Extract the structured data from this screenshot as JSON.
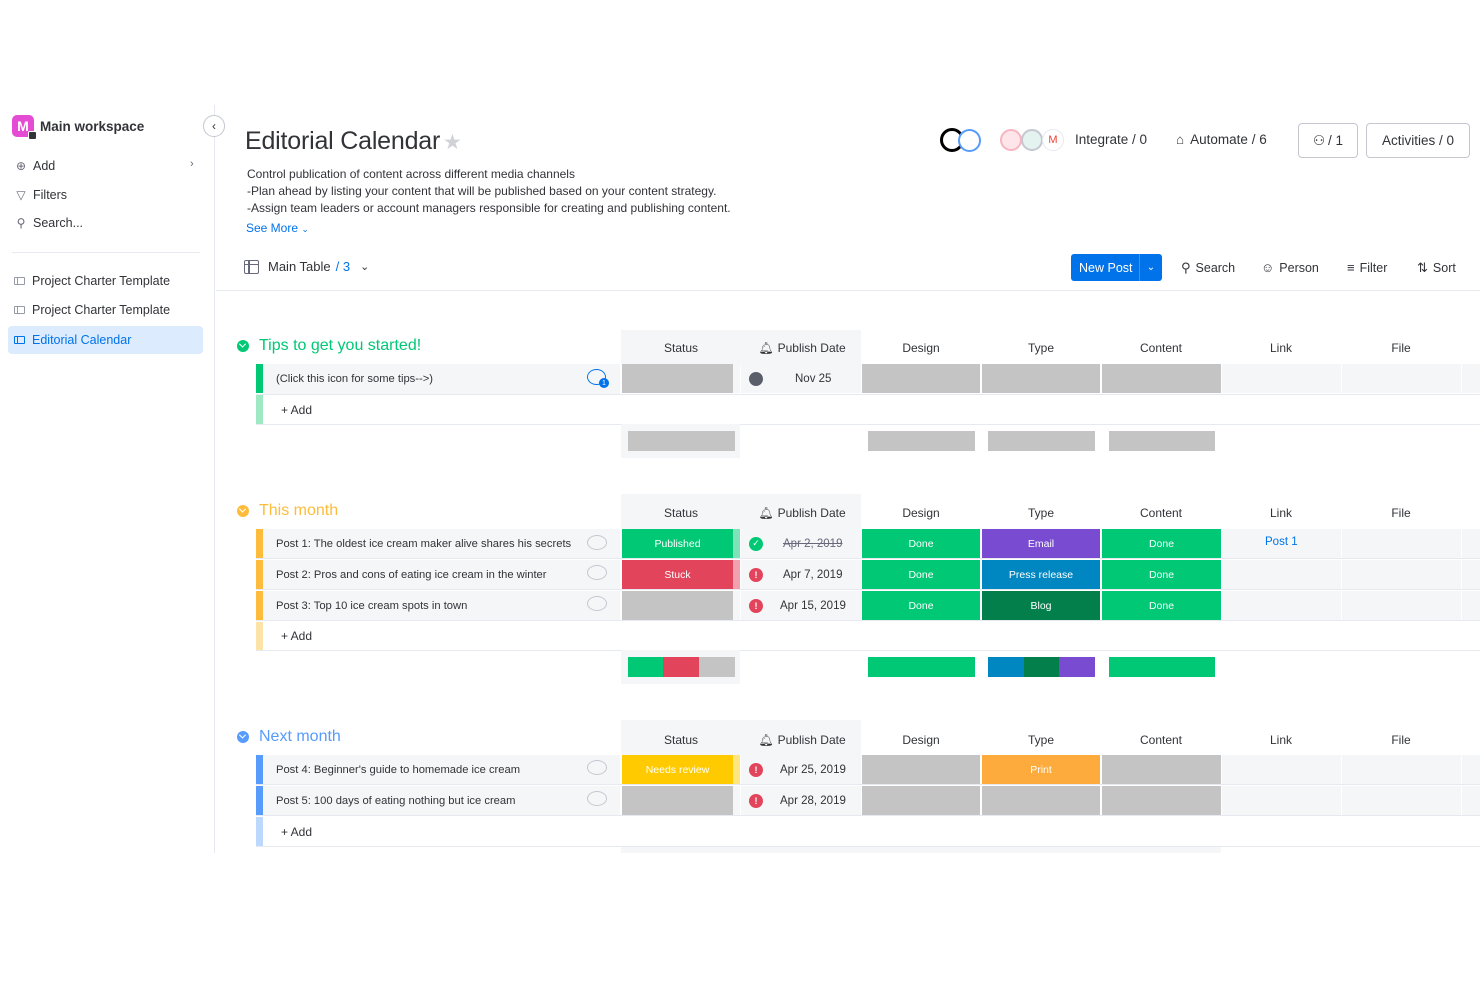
{
  "workspace": {
    "logo_letter": "M",
    "name": "Main workspace"
  },
  "sidebar": {
    "actions": [
      {
        "icon": "plus-circle-icon",
        "label": "Add"
      },
      {
        "icon": "filter-icon",
        "label": "Filters"
      },
      {
        "icon": "search-icon",
        "label": "Search..."
      }
    ],
    "boards": [
      {
        "label": "Project Charter Template",
        "active": false
      },
      {
        "label": "Project Charter Template",
        "active": false
      },
      {
        "label": "Editorial Calendar",
        "active": true
      }
    ]
  },
  "board": {
    "title": "Editorial Calendar",
    "description": [
      "Control publication of content across different media channels",
      "-Plan ahead by listing your content that will be published based on your content strategy.",
      "-Assign team leaders or account managers responsible for creating and publishing content."
    ],
    "see_more": "See More"
  },
  "header_actions": {
    "integrate": "Integrate / 0",
    "automate": "Automate / 6",
    "members": "/ 1",
    "activities": "Activities / 0"
  },
  "toolbar": {
    "view_name": "Main Table",
    "view_count": "/ 3",
    "new_item": "New Post",
    "search": "Search",
    "person": "Person",
    "filter": "Filter",
    "sort": "Sort"
  },
  "columns": [
    "Status",
    "Publish Date",
    "Design",
    "Type",
    "Content",
    "Link",
    "File"
  ],
  "colors": {
    "green": "#00c875",
    "red": "#e2445c",
    "purple": "#784bd1",
    "blue": "#0086c0",
    "dark_green": "#037f4c",
    "yellow": "#fdbc3c",
    "orange": "#fdab3d",
    "grey": "#c4c4c4",
    "accent": "#0073ea"
  },
  "groups": [
    {
      "title": "Tips to get you started!",
      "color": "#00c875",
      "add_label": "+ Add",
      "rows": [
        {
          "name": "(Click this icon for some tips-->)",
          "status": "",
          "date": "Nov 25",
          "date_state": "clock"
        }
      ]
    },
    {
      "title": "This month",
      "color": "#fdbc3c",
      "add_label": "+ Add",
      "rows": [
        {
          "name": "Post 1: The oldest ice cream maker alive shares his secrets",
          "status": "Published",
          "date": "Apr 2, 2019",
          "date_state": "done",
          "design": "Done",
          "type": "Email",
          "content": "Done",
          "link": "Post 1"
        },
        {
          "name": "Post 2: Pros and cons of eating ice cream in the winter",
          "status": "Stuck",
          "date": "Apr 7, 2019",
          "date_state": "overdue",
          "design": "Done",
          "type": "Press release",
          "content": "Done"
        },
        {
          "name": "Post 3: Top 10 ice cream spots in town",
          "status": "",
          "date": "Apr 15, 2019",
          "date_state": "overdue",
          "design": "Done",
          "type": "Blog",
          "content": "Done"
        }
      ]
    },
    {
      "title": "Next month",
      "color": "#579bfc",
      "add_label": "+ Add",
      "rows": [
        {
          "name": "Post 4: Beginner's guide to homemade ice cream",
          "status": "Needs review",
          "date": "Apr 25, 2019",
          "date_state": "overdue",
          "type": "Print"
        },
        {
          "name": "Post 5: 100 days of eating nothing but ice cream",
          "status": "",
          "date": "Apr 28, 2019",
          "date_state": "overdue"
        }
      ]
    }
  ]
}
